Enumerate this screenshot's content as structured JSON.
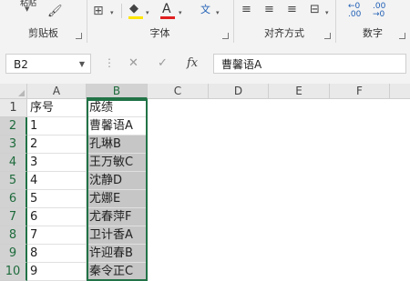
{
  "ribbon": {
    "clipboard": {
      "label": "剪贴板",
      "paste_label": "粘贴"
    },
    "font": {
      "label": "字体"
    },
    "alignment": {
      "label": "对齐方式"
    },
    "number": {
      "label": "数字"
    }
  },
  "formula_bar": {
    "name_box": "B2",
    "formula": "曹馨语A"
  },
  "columns": [
    "A",
    "B",
    "C",
    "D",
    "E",
    "F"
  ],
  "rows": [
    {
      "num": "1",
      "a": "序号",
      "b": "成绩"
    },
    {
      "num": "2",
      "a": "1",
      "b": "曹馨语A"
    },
    {
      "num": "3",
      "a": "2",
      "b": "孔琳B"
    },
    {
      "num": "4",
      "a": "3",
      "b": "王万敏C"
    },
    {
      "num": "5",
      "a": "4",
      "b": "沈静D"
    },
    {
      "num": "6",
      "a": "5",
      "b": "尤娜E"
    },
    {
      "num": "7",
      "a": "6",
      "b": "尤春萍F"
    },
    {
      "num": "8",
      "a": "7",
      "b": "卫计香A"
    },
    {
      "num": "9",
      "a": "8",
      "b": "许迎春B"
    },
    {
      "num": "10",
      "a": "9",
      "b": "秦令正C"
    }
  ],
  "selection": {
    "active_cell": "B2",
    "range": "B2:B10"
  },
  "colors": {
    "accent": "#217346",
    "selection_fill": "#c6c6c6"
  }
}
